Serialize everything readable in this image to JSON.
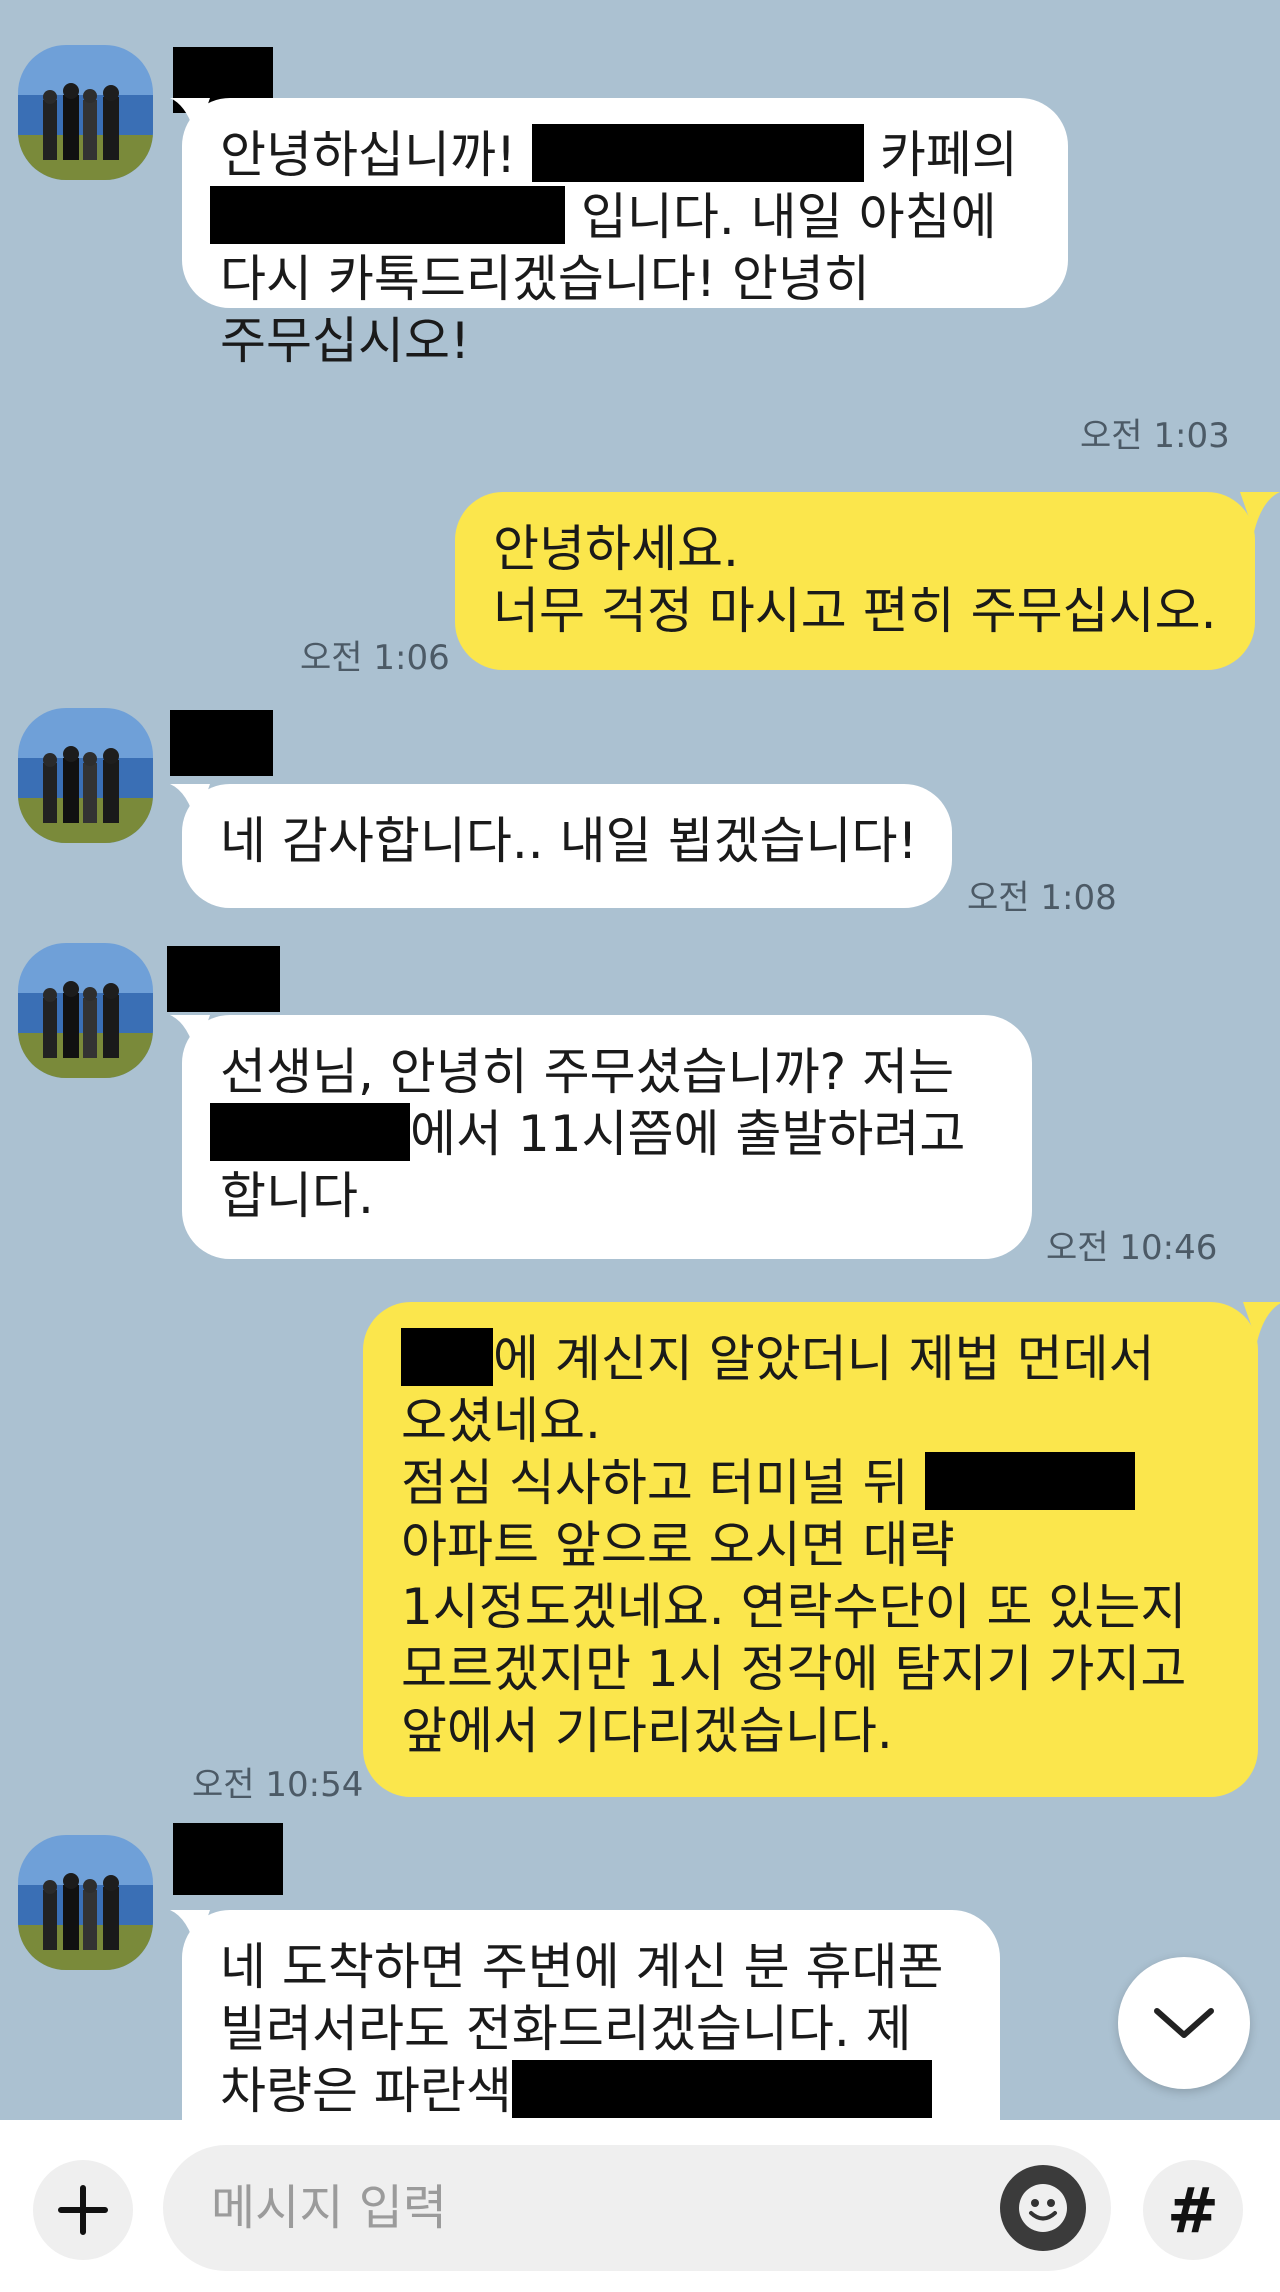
{
  "messages": [
    {
      "sender": "other",
      "lines": [
        [
          "안녕하십니까! ",
          "[R]",
          " 카페의"
        ],
        [
          "[R]",
          " 입니다. 내일 아침에"
        ],
        [
          "다시 카톡드리겠습니다! 안녕히"
        ],
        [
          "주무십시오!"
        ]
      ],
      "time": "오전 1:03"
    },
    {
      "sender": "me",
      "lines": [
        [
          "안녕하세요."
        ],
        [
          "너무 걱정 마시고 편히 주무십시오."
        ]
      ],
      "time": "오전 1:06"
    },
    {
      "sender": "other",
      "lines": [
        [
          "네 감사합니다.. 내일 뵙겠습니다!"
        ]
      ],
      "time": "오전 1:08"
    },
    {
      "sender": "other",
      "lines": [
        [
          "선생님, 안녕히 주무셨습니까? 저는"
        ],
        [
          "[R]",
          "에서 11시쯤에 출발하려고"
        ],
        [
          "합니다."
        ]
      ],
      "time": "오전 10:46"
    },
    {
      "sender": "me",
      "lines": [
        [
          "[R]",
          "에 계신지 알았더니 제법 먼데서"
        ],
        [
          "오셨네요."
        ],
        [
          "점심 식사하고 터미널 뒤 ",
          "[R]"
        ],
        [
          "아파트 앞으로 오시면 대략"
        ],
        [
          "1시정도겠네요.  연락수단이 또 있는지"
        ],
        [
          "모르겠지만 1시 정각에 탐지기 가지고"
        ],
        [
          "앞에서 기다리겠습니다."
        ]
      ],
      "time": "오전 10:54"
    },
    {
      "sender": "other",
      "lines": [
        [
          "네 도착하면 주변에 계신 분 휴대폰"
        ],
        [
          "빌려서라도 전화드리겠습니다. 제"
        ],
        [
          "차량은 파란색",
          "[R]"
        ]
      ],
      "time": ""
    }
  ],
  "composer": {
    "placeholder": "메시지 입력",
    "plus_icon": "plus-icon",
    "emoji_icon": "emoji-icon",
    "hash_label": "#"
  },
  "colors": {
    "background": "#abc1d1",
    "my_bubble": "#fbe64c",
    "their_bubble": "#ffffff"
  }
}
